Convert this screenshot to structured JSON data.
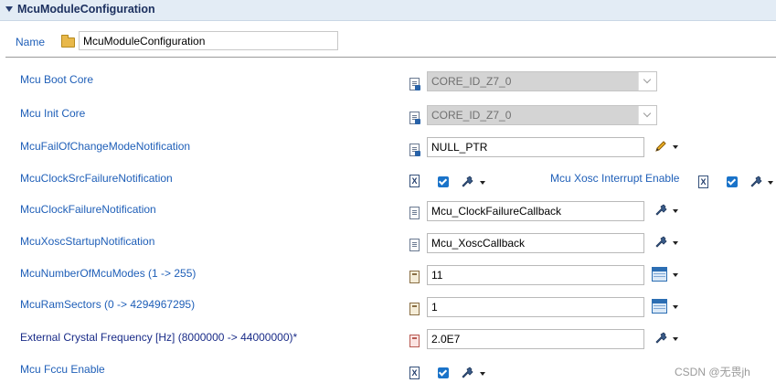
{
  "section": {
    "title": "McuModuleConfiguration"
  },
  "name_row": {
    "label": "Name",
    "value": "McuModuleConfiguration"
  },
  "rows": {
    "boot_core": {
      "label": "Mcu Boot Core",
      "value": "CORE_ID_Z7_0"
    },
    "init_core": {
      "label": "Mcu Init Core",
      "value": "CORE_ID_Z7_0"
    },
    "fail_change_mode": {
      "label": "McuFailOfChangeModeNotification",
      "value": "NULL_PTR"
    },
    "clock_src_failure": {
      "label": "McuClockSrcFailureNotification",
      "checked": true
    },
    "xosc_interrupt": {
      "label": "Mcu Xosc Interrupt Enable",
      "checked": true
    },
    "clock_failure": {
      "label": "McuClockFailureNotification",
      "value": "Mcu_ClockFailureCallback"
    },
    "xosc_startup": {
      "label": "McuXoscStartupNotification",
      "value": "Mcu_XoscCallback"
    },
    "num_modes": {
      "label": "McuNumberOfMcuModes (1 -> 255)",
      "value": "11"
    },
    "ram_sectors": {
      "label": "McuRamSectors (0 -> 4294967295)",
      "value": "1"
    },
    "crystal_freq": {
      "label": "External Crystal Frequency [Hz] (8000000 -> 44000000)*",
      "value": "2.0E7"
    },
    "fccu_enable": {
      "label": "Mcu Fccu Enable",
      "checked": true
    }
  },
  "icons": {
    "x_glyph": "X",
    "accent": "#1a73c9",
    "label_color": "#1f5fb8"
  },
  "watermark": "CSDN @无畏jh"
}
